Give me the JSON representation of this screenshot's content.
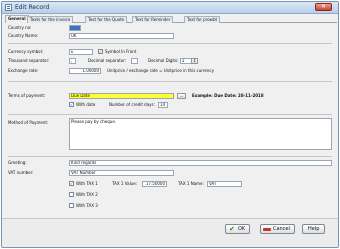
{
  "window": {
    "title": "Edit Record"
  },
  "tabs": [
    "General",
    "Texts for the invoice",
    "Text for the Quote",
    "Text for Reminder",
    "Text for prowbt"
  ],
  "fields": {
    "country_no": {
      "label": "Country no:",
      "value": ""
    },
    "country_name": {
      "label": "Country Name:",
      "value": "UK"
    },
    "currency_symbol": {
      "label": "Currency symbol:",
      "value": "£",
      "symbol_in_front_label": "Symbol In Front",
      "symbol_in_front_checked": true
    },
    "thousand_separator": {
      "label": "Thousand separator:",
      "value": ",",
      "decimal_separator_label": "Decimal separator:",
      "decimal_separator_value": ".",
      "decimal_digits_label": "Decimal Digits:",
      "decimal_digits_value": "2"
    },
    "exchange_rate": {
      "label": "Exchange rate:",
      "value": "1.00000",
      "note": "Unitprice / exchange rate = Unitprice in this currency"
    },
    "terms_of_payment": {
      "label": "Terms of payment:",
      "value": "Due Date",
      "browse_label": "...",
      "example": "Example: Due Date: 28-11-2018",
      "with_date_label": "With date",
      "with_date_checked": true,
      "credit_days_label": "Number of credit days:",
      "credit_days_value": "14"
    },
    "method_of_payment": {
      "label": "Method of Payment:",
      "value": "Please pay by cheque."
    },
    "greeting": {
      "label": "Greeting:",
      "value": "Kind regards"
    },
    "vat_number": {
      "label": "VAT number:",
      "value": "VAT Number"
    },
    "tax1": {
      "label": "With TAX 1",
      "checked": true,
      "value_label": "TAX 1 Value:",
      "value": "17.50000",
      "name_label": "TAX 1 Name:",
      "name": "VAT"
    },
    "tax2": {
      "label": "With TAX 2",
      "checked": false
    },
    "tax3": {
      "label": "With TAX 3",
      "checked": false
    }
  },
  "buttons": {
    "ok": "OK",
    "cancel": "Cancel",
    "help": "Help"
  },
  "icons": {
    "title": "record-icon",
    "ok": "check-icon",
    "cancel": "cancel-icon",
    "close": "close-icon"
  },
  "colors": {
    "highlight": "#ffff33",
    "selection": "#3f73c9",
    "ok_icon": "#2f8d24",
    "cancel_icon": "#c8332b"
  }
}
